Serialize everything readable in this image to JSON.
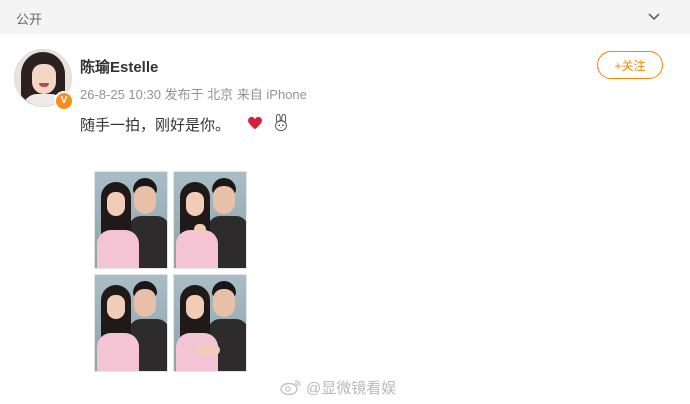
{
  "header": {
    "visibility_label": "公开"
  },
  "post": {
    "author": {
      "name": "陈瑜Estelle",
      "verified_badge": "V"
    },
    "meta": "26-8-25 10:30 发布于 北京 来自 iPhone",
    "follow_label": "+关注",
    "text": "随手一拍，刚好是你。",
    "emoji": [
      "heart-emoji",
      "rabbit-emoji"
    ]
  },
  "watermark": {
    "text": "@显微镜看娱"
  },
  "colors": {
    "accent": "#ff8200",
    "badge": "#f78e1e",
    "meta_gray": "#939393"
  }
}
